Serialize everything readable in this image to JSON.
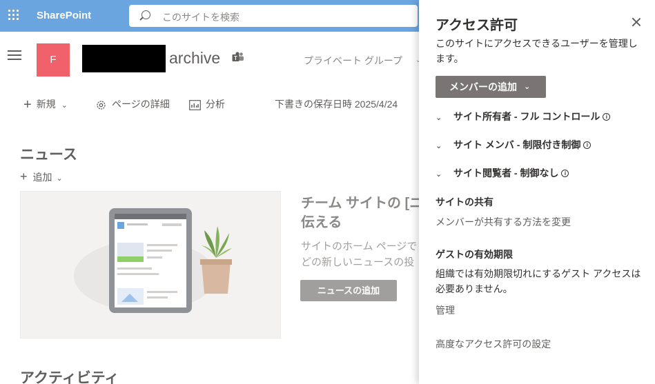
{
  "suitebar": {
    "brand": "SharePoint",
    "search_placeholder": "このサイトを検索"
  },
  "site": {
    "logo_letter": "F",
    "title": "archive",
    "privacy": "プライベート グループ"
  },
  "commandbar": {
    "new_label": "新規",
    "page_details_label": "ページの詳細",
    "analytics_label": "分析",
    "draft_saved": "下書きの保存日時 2025/4/24"
  },
  "news": {
    "title": "ニュース",
    "add_label": "追加",
    "heading": "チーム サイトの [ニ\n伝える",
    "description": "サイトのホーム ページで\nどの新しいニュースの投",
    "add_news_button": "ニュースの追加"
  },
  "activity": {
    "title": "アクティビティ"
  },
  "panel": {
    "title": "アクセス許可",
    "description": "このサイトにアクセスできるユーザーを管理します。",
    "add_member_button": "メンバーの追加",
    "groups": [
      {
        "label": "サイト所有者 - フル コントロール"
      },
      {
        "label": "サイト メンバ - 制限付き制御"
      },
      {
        "label": "サイト閲覧者 - 制御なし"
      }
    ],
    "sharing": {
      "heading": "サイトの共有",
      "link": "メンバーが共有する方法を変更"
    },
    "guest": {
      "heading": "ゲストの有効期限",
      "text": "組織では有効期限切れにするゲスト アクセスは必要ありません。",
      "manage": "管理"
    },
    "advanced": "高度なアクセス許可の設定"
  },
  "colors": {
    "suitebar": "#6ba5e0",
    "site_logo": "#f1616c",
    "add_member_button": "#7a7574"
  }
}
